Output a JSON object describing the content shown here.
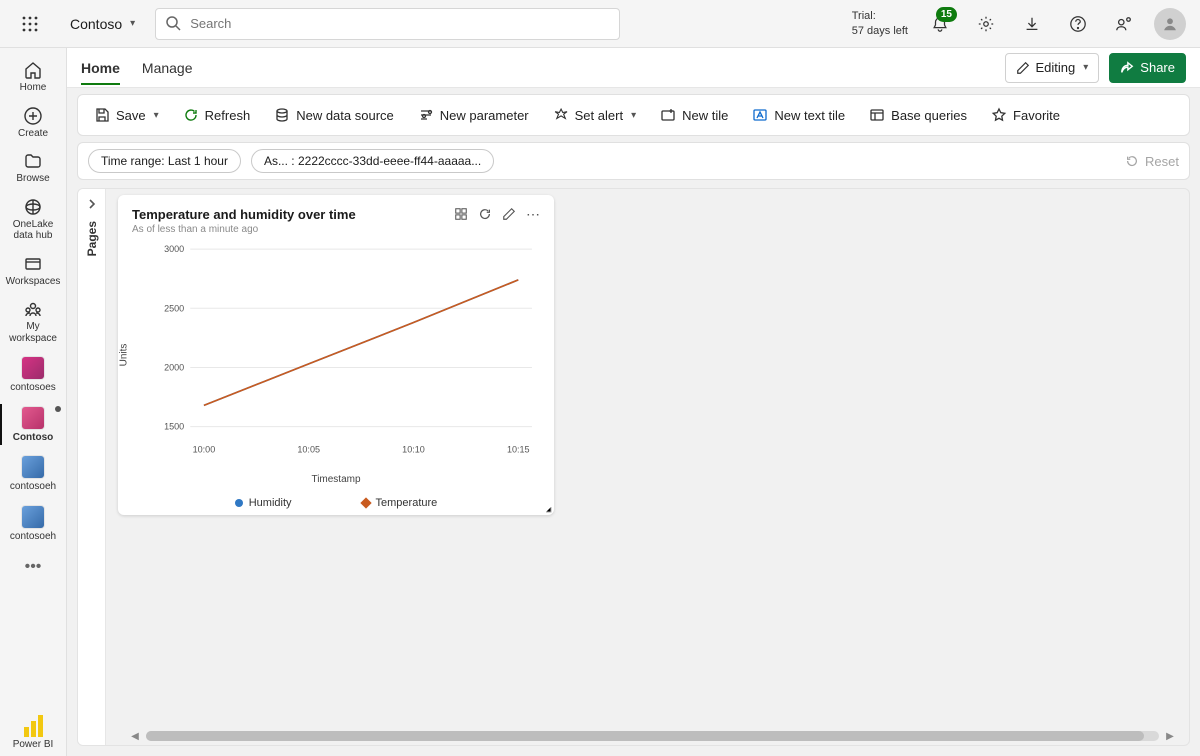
{
  "header": {
    "tenant": "Contoso",
    "search_placeholder": "Search",
    "trial_line1": "Trial:",
    "trial_line2": "57 days left",
    "notif_count": "15"
  },
  "rail": {
    "home": "Home",
    "create": "Create",
    "browse": "Browse",
    "onelake": "OneLake data hub",
    "workspaces": "Workspaces",
    "myws": "My workspace",
    "ws1": "contosoes",
    "ws2": "Contoso",
    "ws3": "contosoeh",
    "ws4": "contosoeh",
    "powerbi": "Power BI"
  },
  "tabs": {
    "home": "Home",
    "manage": "Manage",
    "editing": "Editing",
    "share": "Share"
  },
  "toolbar": {
    "save": "Save",
    "refresh": "Refresh",
    "new_ds": "New data source",
    "new_param": "New parameter",
    "set_alert": "Set alert",
    "new_tile": "New tile",
    "new_text": "New text tile",
    "base_queries": "Base queries",
    "favorite": "Favorite"
  },
  "filters": {
    "time_range": "Time range: Last 1 hour",
    "asset": "As... : 2222cccc-33dd-eeee-ff44-aaaaa...",
    "reset": "Reset"
  },
  "pages_label": "Pages",
  "tile": {
    "title": "Temperature and humidity over time",
    "subtitle": "As of less than a minute ago",
    "legend_humidity": "Humidity",
    "legend_temperature": "Temperature"
  },
  "chart_data": {
    "type": "line",
    "title": "Temperature and humidity over time",
    "xlabel": "Timestamp",
    "ylabel": "Units",
    "x_categories": [
      "10:00",
      "10:05",
      "10:10",
      "10:15"
    ],
    "ylim": [
      1400,
      3000
    ],
    "yticks": [
      1500,
      2000,
      2500,
      3000
    ],
    "series": [
      {
        "name": "Humidity",
        "color": "#2f78c4",
        "values": [
          1680,
          2030,
          2380,
          2740
        ]
      },
      {
        "name": "Temperature",
        "color": "#c95b1f",
        "values": [
          1680,
          2030,
          2380,
          2740
        ]
      }
    ]
  }
}
